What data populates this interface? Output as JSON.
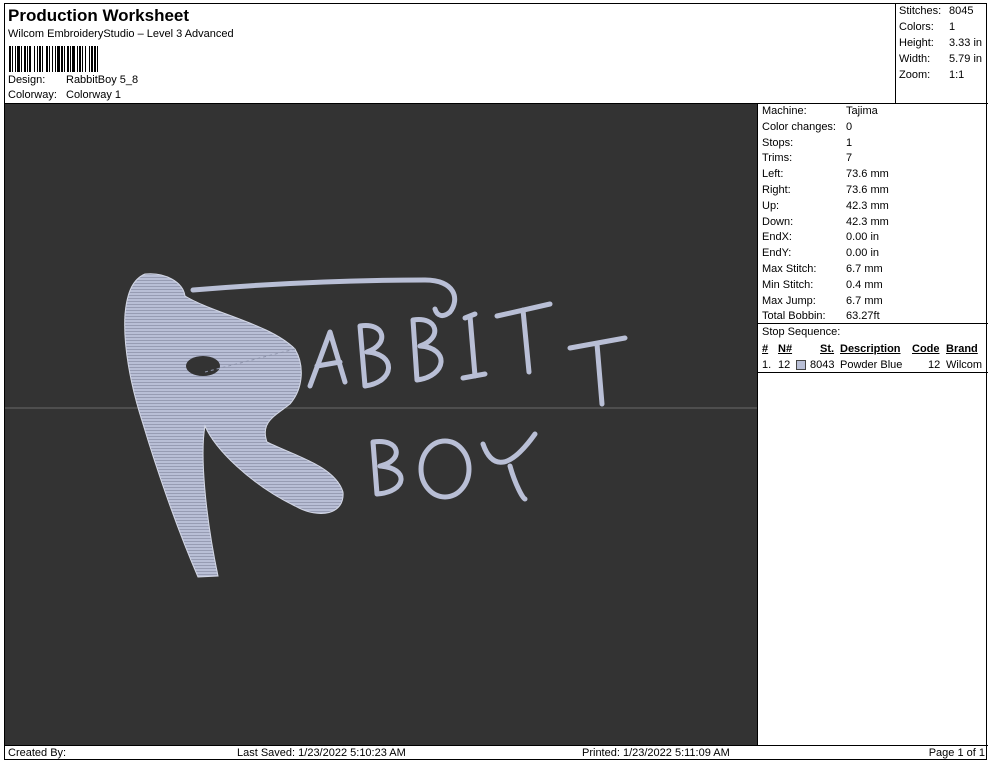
{
  "header": {
    "title": "Production Worksheet",
    "subtitle": "Wilcom EmbroideryStudio – Level 3 Advanced",
    "design_label": "Design:",
    "design_value": "RabbitBoy 5_8",
    "colorway_label": "Colorway:",
    "colorway_value": "Colorway 1"
  },
  "stats": [
    {
      "label": "Stitches:",
      "value": "8045"
    },
    {
      "label": "Colors:",
      "value": "1"
    },
    {
      "label": "Height:",
      "value": "3.33 in"
    },
    {
      "label": "Width:",
      "value": "5.79 in"
    },
    {
      "label": "Zoom:",
      "value": "1:1"
    }
  ],
  "machine_props": [
    {
      "label": "Machine:",
      "value": "Tajima"
    },
    {
      "label": "Color changes:",
      "value": "0"
    },
    {
      "label": "Stops:",
      "value": "1"
    },
    {
      "label": "Trims:",
      "value": "7"
    },
    {
      "label": "Left:",
      "value": "73.6 mm"
    },
    {
      "label": "Right:",
      "value": "73.6 mm"
    },
    {
      "label": "Up:",
      "value": "42.3 mm"
    },
    {
      "label": "Down:",
      "value": "42.3 mm"
    },
    {
      "label": "EndX:",
      "value": "0.00 in"
    },
    {
      "label": "EndY:",
      "value": "0.00 in"
    },
    {
      "label": "Max Stitch:",
      "value": "6.7 mm"
    },
    {
      "label": "Min Stitch:",
      "value": "0.4 mm"
    },
    {
      "label": "Max Jump:",
      "value": "6.7 mm"
    },
    {
      "label": "Total Bobbin:",
      "value": "63.27ft"
    }
  ],
  "stop_sequence": {
    "title": "Stop Sequence:",
    "columns": [
      "#",
      "N#",
      "St.",
      "Description",
      "Code",
      "Brand"
    ],
    "rows": [
      {
        "index": "1.",
        "n": "12",
        "stitches": "8043",
        "description": "Powder Blue",
        "code": "12",
        "brand": "Wilcom",
        "color": "#b9bfd6"
      }
    ]
  },
  "design_canvas": {
    "background": "#333333",
    "thread_color": "#b9bfd6"
  },
  "footer": {
    "created_by": "Created By:",
    "last_saved": "Last Saved: 1/23/2022 5:10:23 AM",
    "printed": "Printed: 1/23/2022 5:11:09 AM",
    "page": "Page 1 of 1"
  }
}
